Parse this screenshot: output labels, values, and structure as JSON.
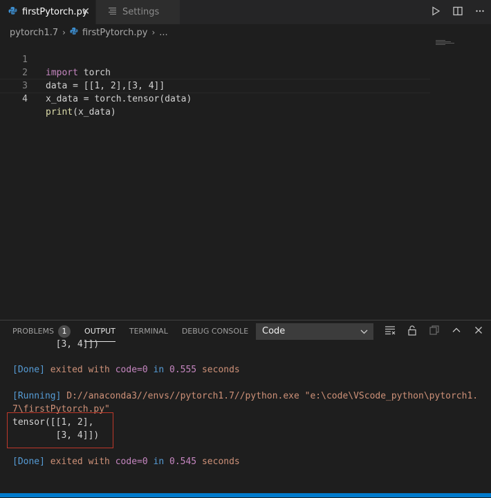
{
  "tabs": [
    {
      "label": "firstPytorch.py",
      "icon": "python-file-icon",
      "active": true,
      "close": "✕"
    },
    {
      "label": "Settings",
      "icon": "settings-file-icon",
      "active": false
    }
  ],
  "breadcrumb": {
    "folder": "pytorch1.7",
    "file": "firstPytorch.py",
    "more": "..."
  },
  "editor": {
    "line_numbers": [
      "1",
      "2",
      "3",
      "4"
    ],
    "current_line": 4,
    "lines": [
      {
        "kw": "import",
        "rest": " torch"
      },
      {
        "text": "data = [[1, 2],[3, 4]]"
      },
      {
        "text": "x_data = torch.tensor(data)"
      },
      {
        "fn": "print",
        "rest": "(x_data)"
      }
    ]
  },
  "panel": {
    "tabs": [
      {
        "label": "PROBLEMS",
        "badge": "1"
      },
      {
        "label": "OUTPUT",
        "active": true
      },
      {
        "label": "TERMINAL"
      },
      {
        "label": "DEBUG CONSOLE"
      }
    ],
    "channel": "Code",
    "output": {
      "prev_tail": "        [3, 4]])",
      "done1": {
        "tag": "[Done]",
        "a": " exited with ",
        "b": "code=0",
        "c": " in ",
        "d": "0.555",
        "e": " seconds"
      },
      "running": {
        "tag": "[Running]",
        "cmd1": " D://anaconda3//envs//pytorch1.7//python.exe \"e:\\code\\VScode_python\\pytorch1.",
        "cmd2": "7\\firstPytorch.py\""
      },
      "result1": "tensor([[1, 2],",
      "result2": "        [3, 4]])",
      "done2": {
        "tag": "[Done]",
        "a": " exited with ",
        "b": "code=0",
        "c": " in ",
        "d": "0.545",
        "e": " seconds"
      }
    }
  },
  "colors": {
    "accent": "#007acc",
    "highlight_box": "#c0392b"
  }
}
